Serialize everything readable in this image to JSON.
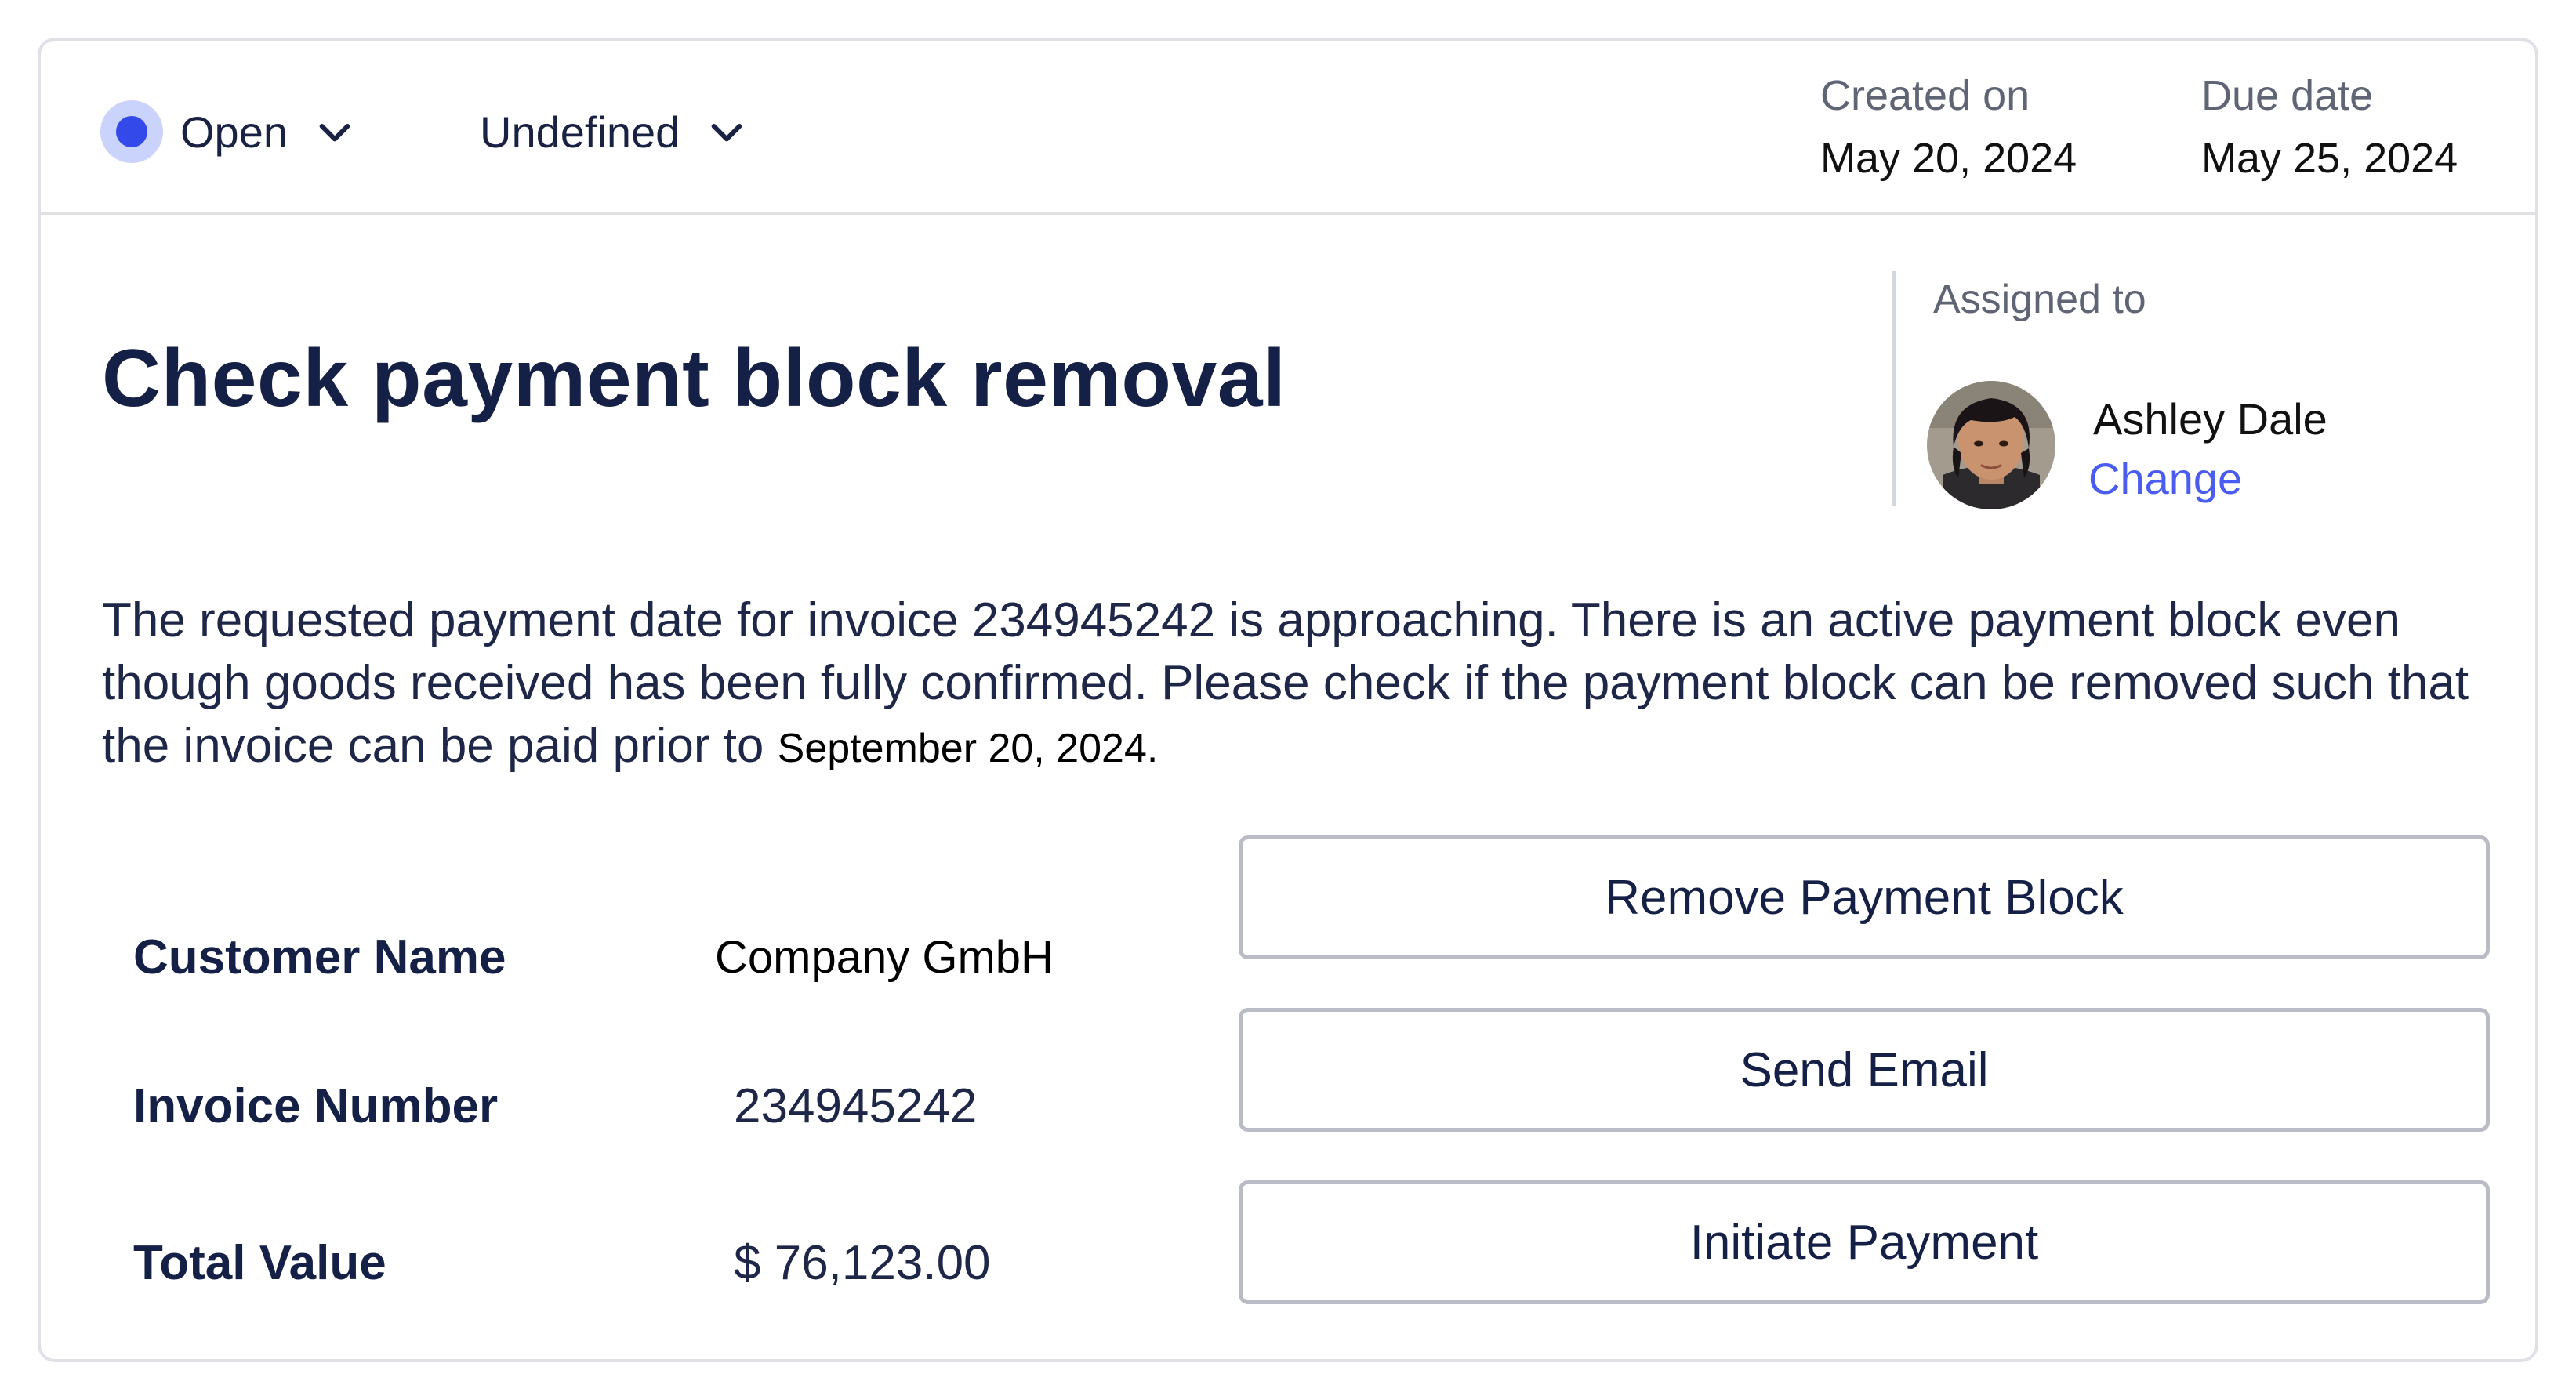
{
  "header": {
    "status_label": "Open",
    "priority_label": "Undefined",
    "created_label": "Created on",
    "created_value": "May 20, 2024",
    "due_label": "Due date",
    "due_value": "May 25, 2024"
  },
  "task": {
    "title": "Check payment block removal",
    "description_text": "The requested payment date for invoice 234945242 is approaching. There is an active payment block even though goods received has been fully confirmed. Please check if the payment block can be removed such that the invoice can be paid prior to",
    "description_date": "September 20, 2024",
    "description_end": "."
  },
  "assignment": {
    "label": "Assigned to",
    "name": "Ashley Dale",
    "change_label": "Change"
  },
  "fields": [
    {
      "label": "Customer Name",
      "value": "Company GmbH"
    },
    {
      "label": "Invoice Number",
      "value": "234945242"
    },
    {
      "label": "Total Value",
      "value": "$ 76,123.00"
    }
  ],
  "actions": [
    {
      "label": "Remove Payment Block"
    },
    {
      "label": "Send Email"
    },
    {
      "label": "Initiate Payment"
    }
  ],
  "colors": {
    "accent": "#3349e9",
    "link": "#4b5cf0",
    "heading": "#152046",
    "border": "#dfe1e7"
  }
}
